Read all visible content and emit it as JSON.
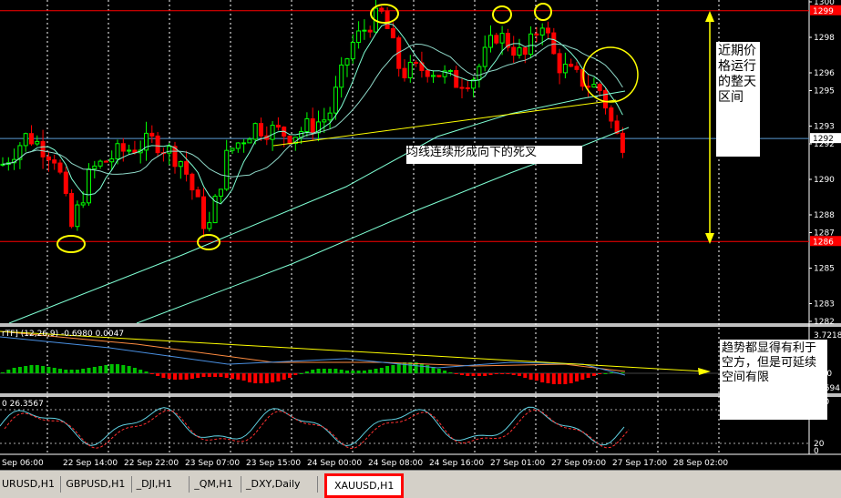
{
  "chart_data": {
    "type": "candlestick",
    "symbol": "XAUUSD",
    "timeframe": "H1",
    "price_axis": [
      "1300",
      "1298",
      "1296",
      "1295",
      "1293",
      "1292",
      "1290",
      "1288",
      "1287",
      "1285",
      "1283",
      "1282"
    ],
    "price_ylim": [
      1282,
      1300
    ],
    "resistance_level": 1299.5,
    "resistance_label": "1299",
    "support_level": 1286.5,
    "support_label": "1286",
    "current_price": 1292.3,
    "current_price_label": "1292",
    "time_axis": [
      "Sep 06:00",
      "22 Sep 14:00",
      "22 Sep 22:00",
      "23 Sep 07:00",
      "23 Sep 15:00",
      "24 Sep 00:00",
      "24 Sep 08:00",
      "24 Sep 16:00",
      "27 Sep 01:00",
      "27 Sep 09:00",
      "27 Sep 17:00",
      "28 Sep 02:00"
    ],
    "macd_label": "rTF] (12,26,9) -0.6980 0.0047",
    "macd_axis": [
      "3.7218",
      "0.00",
      "-1.594"
    ],
    "stoch_label": "0 26.3567",
    "stoch_axis": [
      "100",
      "80",
      "20",
      "0"
    ],
    "annotation_cross": "均线连续形成向下的死叉",
    "annotation_range": "近期价格运行的整天区间",
    "annotation_macd": "趋势都显得有利于空方，但是可延续空间有限",
    "colors": {
      "background": "#000000",
      "bull": "#00ff00",
      "bear": "#ff0000",
      "grid": "#ffffff",
      "ma_fast": "#ffffff",
      "ma_slow": "#7fffd4",
      "resistance": "#ff0000",
      "highlight": "#ffff00"
    }
  },
  "tabs": [
    {
      "label": "URUSD,H1"
    },
    {
      "label": "GBPUSD,H1"
    },
    {
      "label": "_DJI,H1"
    },
    {
      "label": "_QM,H1"
    },
    {
      "label": "_DXY,Daily"
    },
    {
      "label": "XAUUSD,H1",
      "active": true
    }
  ]
}
